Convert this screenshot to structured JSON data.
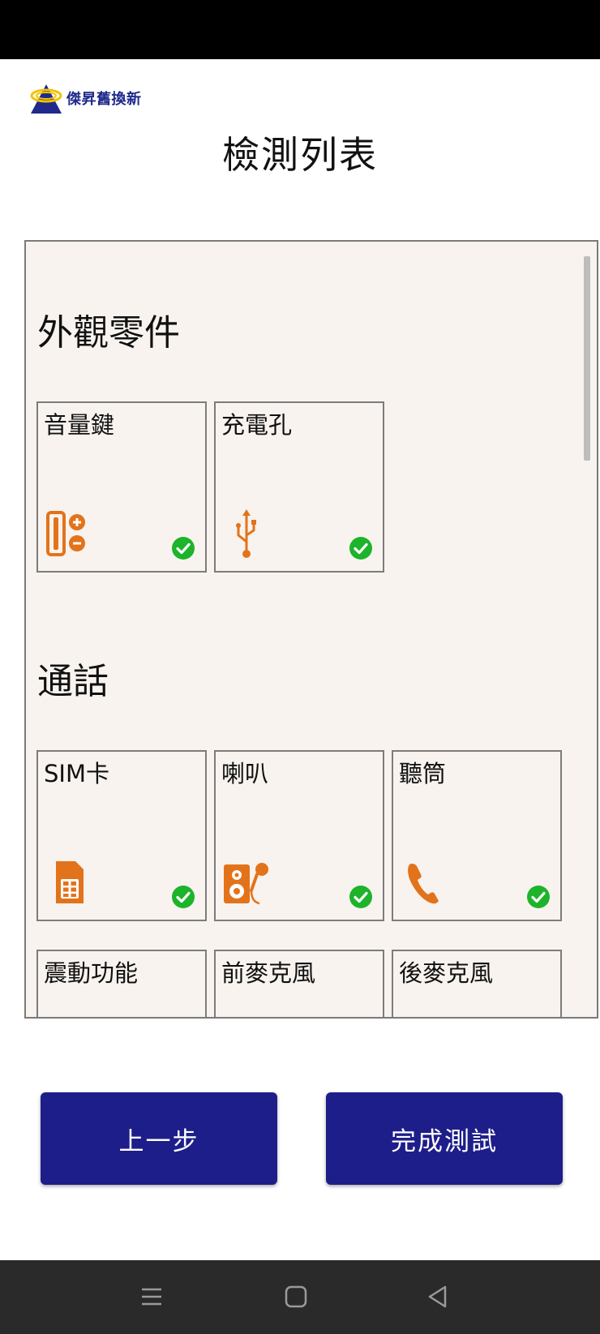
{
  "app": {
    "brand_name": "傑昇舊換新",
    "page_title": "檢測列表"
  },
  "sections": [
    {
      "title": "外觀零件",
      "items": [
        {
          "label": "音量鍵",
          "icon": "volume-keys-icon",
          "status": "passed"
        },
        {
          "label": "充電孔",
          "icon": "usb-icon",
          "status": "passed"
        }
      ]
    },
    {
      "title": "通話",
      "items": [
        {
          "label": "SIM卡",
          "icon": "sim-card-icon",
          "status": "passed"
        },
        {
          "label": "喇叭",
          "icon": "speaker-microphone-icon",
          "status": "passed"
        },
        {
          "label": "聽筒",
          "icon": "phone-receiver-icon",
          "status": "passed"
        },
        {
          "label": "震動功能"
        },
        {
          "label": "前麥克風"
        },
        {
          "label": "後麥克風"
        }
      ]
    }
  ],
  "buttons": {
    "prev": "上一步",
    "finish": "完成測試"
  },
  "colors": {
    "accent_orange": "#e3731a",
    "check_green": "#1db32a",
    "button_navy": "#1e1e8a",
    "panel_bg": "#f8f3ef"
  }
}
